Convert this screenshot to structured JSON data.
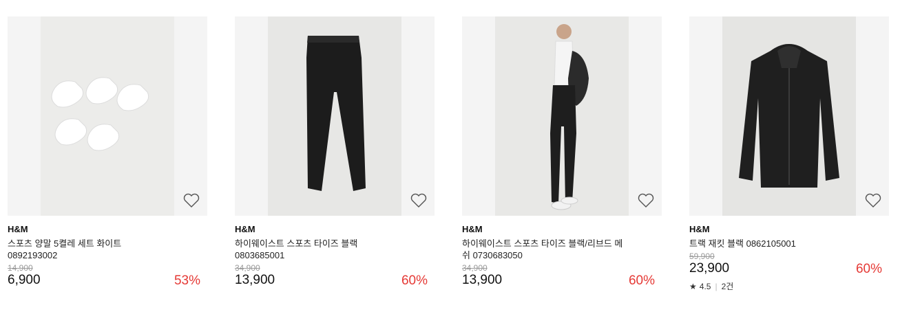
{
  "products": [
    {
      "brand": "H&M",
      "name": "스포츠 양말 5켤레 세트 화이트 0892193002",
      "original_price": "14,900",
      "price": "6,900",
      "discount": "53%"
    },
    {
      "brand": "H&M",
      "name": "하이웨이스트 스포츠 타이즈 블랙 0803685001",
      "original_price": "34,900",
      "price": "13,900",
      "discount": "60%"
    },
    {
      "brand": "H&M",
      "name": "하이웨이스트 스포츠 타이즈 블랙/리브드 메쉬 0730683050",
      "original_price": "34,900",
      "price": "13,900",
      "discount": "60%"
    },
    {
      "brand": "H&M",
      "name": "트랙 재킷 블랙 0862105001",
      "original_price": "59,900",
      "price": "23,900",
      "discount": "60%",
      "rating": {
        "score": "4.5",
        "count": "2건"
      }
    }
  ],
  "colors": {
    "discount": "#e53935",
    "strike": "#9a9a9a"
  },
  "icons": {
    "wishlist": "heart-outline-icon",
    "rating": "star-icon"
  }
}
